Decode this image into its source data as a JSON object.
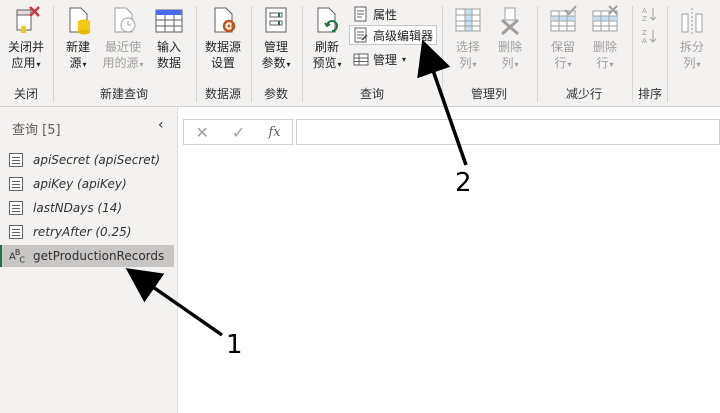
{
  "ribbon": {
    "groups": [
      {
        "label": "关闭",
        "buttons": [
          {
            "line1": "关闭并",
            "line2": "应用"
          }
        ]
      },
      {
        "label": "新建查询",
        "buttons": [
          {
            "line1": "新建",
            "line2": "源"
          },
          {
            "line1": "最近使",
            "line2": "用的源"
          },
          {
            "line1": "输入",
            "line2": "数据"
          }
        ]
      },
      {
        "label": "数据源",
        "buttons": [
          {
            "line1": "数据源",
            "line2": "设置"
          }
        ]
      },
      {
        "label": "参数",
        "buttons": [
          {
            "line1": "管理",
            "line2": "参数"
          }
        ]
      },
      {
        "label": "查询",
        "buttons": [
          {
            "line1": "刷新",
            "line2": "预览"
          }
        ],
        "small": {
          "properties": "属性",
          "advanced_editor": "高级编辑器",
          "manage": "管理"
        }
      },
      {
        "label": "管理列",
        "buttons": [
          {
            "line1": "选择",
            "line2": "列"
          },
          {
            "line1": "删除",
            "line2": "列"
          }
        ]
      },
      {
        "label": "减少行",
        "buttons": [
          {
            "line1": "保留",
            "line2": "行"
          },
          {
            "line1": "删除",
            "line2": "行"
          }
        ]
      },
      {
        "label": "排序",
        "buttons": []
      },
      {
        "label": "",
        "buttons": [
          {
            "line1": "拆分",
            "line2": "列"
          }
        ]
      }
    ]
  },
  "queries": {
    "header": "查询 [5]",
    "items": [
      {
        "label": "apiSecret (apiSecret)"
      },
      {
        "label": "apiKey (apiKey)"
      },
      {
        "label": "lastNDays (14)"
      },
      {
        "label": "retryAfter (0.25)"
      },
      {
        "label": "getProductionRecords"
      }
    ]
  },
  "formula_bar": {
    "cancel": "✕",
    "confirm": "✓",
    "fx": "fx",
    "value": ""
  },
  "annotations": {
    "label1": "1",
    "label2": "2"
  },
  "colors": {
    "accent": "#217346",
    "selected": "#c8c6c4",
    "ribbon": "#f3f2f1"
  }
}
